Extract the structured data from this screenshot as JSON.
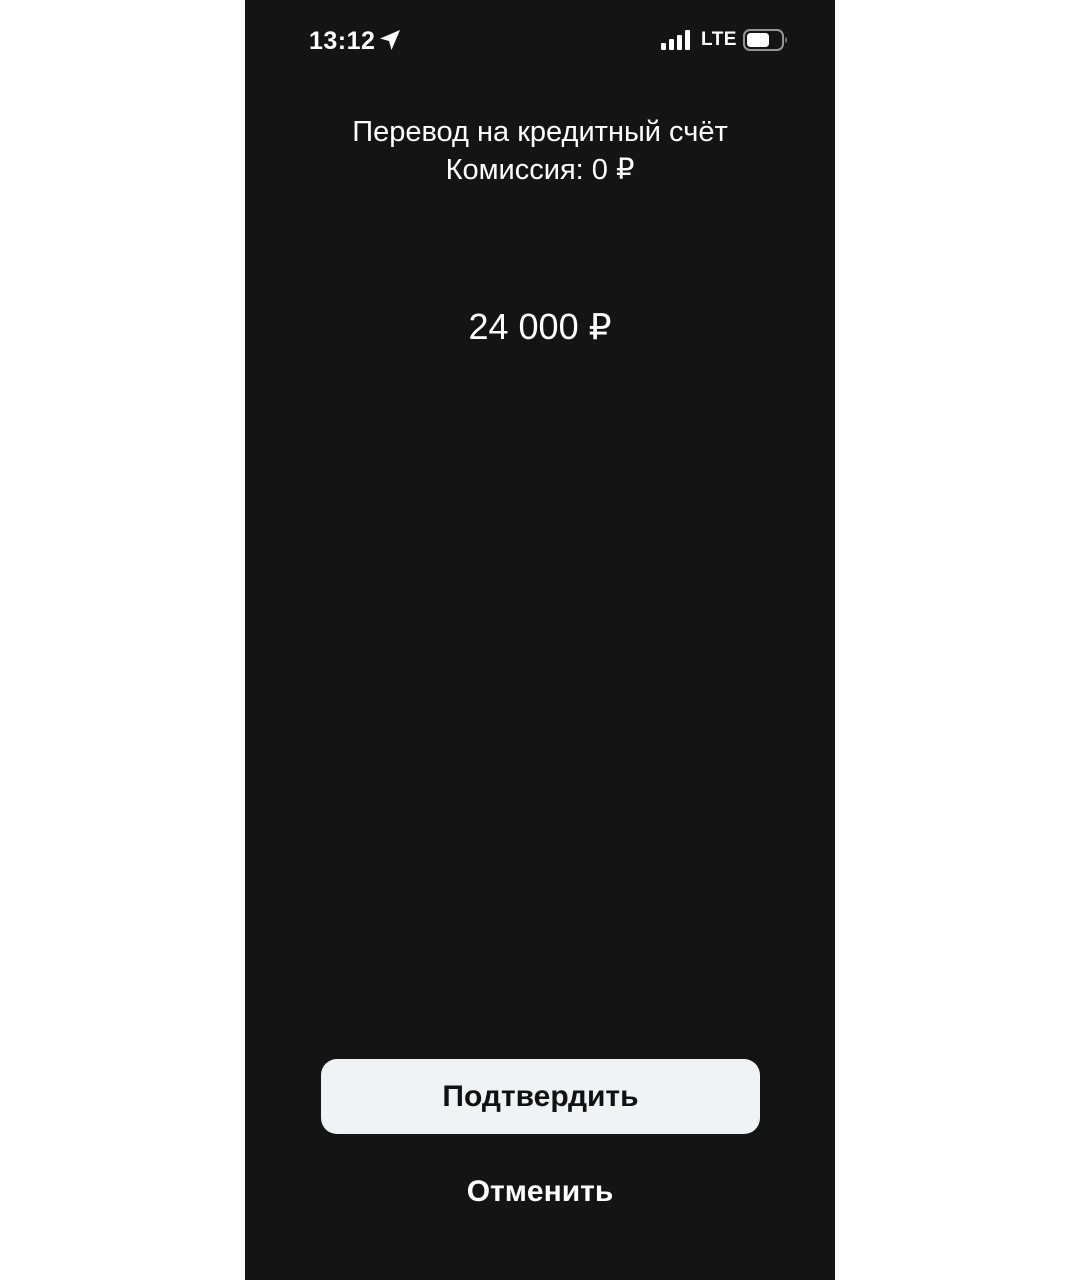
{
  "status_bar": {
    "time": "13:12",
    "network": "LTE",
    "icons": {
      "location": "location-arrow-icon",
      "signal": "cellular-signal-icon",
      "battery": "battery-icon"
    }
  },
  "transfer": {
    "title": "Перевод на кредитный счёт",
    "commission": "Комиссия: 0 ₽",
    "amount": "24 000 ₽"
  },
  "actions": {
    "confirm_label": "Подтвердить",
    "cancel_label": "Отменить"
  },
  "colors": {
    "background": "#141414",
    "text": "#ffffff",
    "confirm_button_bg": "#f1f2f4",
    "confirm_button_text": "#111111"
  }
}
